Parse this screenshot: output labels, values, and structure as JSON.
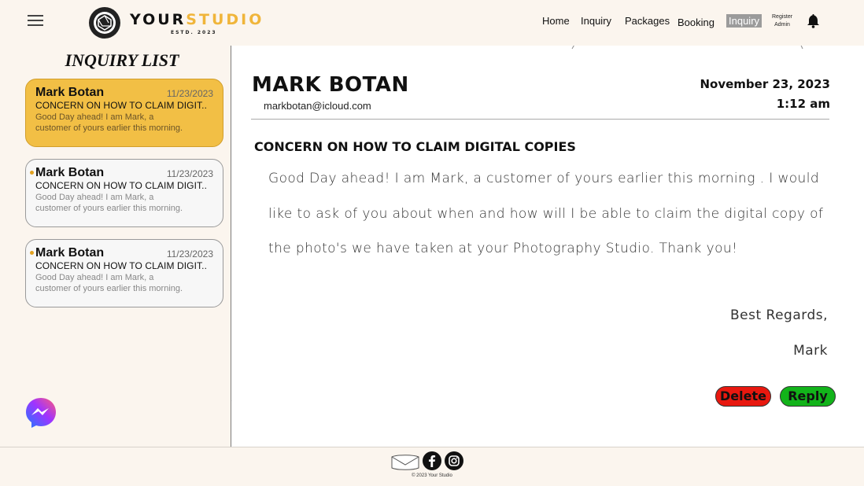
{
  "header": {
    "brand_part1": "YOUR",
    "brand_part2": "STUDIO",
    "brand_sub": "ESTD. 2023",
    "nav": [
      "Home",
      "Inquiry",
      "Packages",
      "Booking",
      "Inquiry"
    ],
    "active_nav": "Inquiry",
    "register_line1": "Register",
    "register_line2": "Admin",
    "icons": {
      "menu": "hamburger-icon",
      "logo": "camera-aperture-icon",
      "bell": "bell-icon"
    }
  },
  "sidebar": {
    "title": "INQUIRY LIST",
    "cards": [
      {
        "name": "Mark Botan",
        "date": "11/23/2023",
        "subject": "CONCERN ON HOW TO CLAIM DIGIT..",
        "preview_line1": "Good Day ahead! I am Mark, a",
        "preview_line2": "customer of yours earlier this morning.",
        "selected": true
      },
      {
        "name": "Mark Botan",
        "date": "11/23/2023",
        "subject": "CONCERN ON HOW TO CLAIM DIGIT..",
        "preview_line1": "Good Day ahead! I am Mark, a",
        "preview_line2": "customer of yours earlier this morning.",
        "selected": false
      },
      {
        "name": "Mark Botan",
        "date": "11/23/2023",
        "subject": "CONCERN ON HOW TO CLAIM DIGIT..",
        "preview_line1": "Good Day ahead! I am Mark, a",
        "preview_line2": "customer of yours earlier this morning.",
        "selected": false
      }
    ],
    "messenger_icon": "messenger-icon"
  },
  "message": {
    "sender": "MARK BOTAN",
    "email": "markbotan@icloud.com",
    "date": "November 23, 2023",
    "time": "1:12 am",
    "subject": "CONCERN ON HOW TO CLAIM DIGITAL COPIES",
    "body_line1": "Good Day ahead! I am Mark, a customer of yours earlier this morning . I would",
    "body_line2": "like to ask of you about when and how will I be able to claim the digital copy of",
    "body_line3": "the photo's we have taken at your Photography Studio. Thank you!",
    "closing": "Best Regards,",
    "signer": "Mark",
    "delete_label": "Delete",
    "reply_label": "Reply"
  },
  "footer": {
    "copyright": "© 2023 Your Studio",
    "icons": [
      "mail-icon",
      "facebook-icon",
      "instagram-icon"
    ]
  },
  "colors": {
    "background_cream": "#fbf5ee",
    "accent_gold": "#f2bf45",
    "delete_red": "#e8180f",
    "reply_green": "#12b31a",
    "active_nav_gray": "#9b9b9b"
  }
}
